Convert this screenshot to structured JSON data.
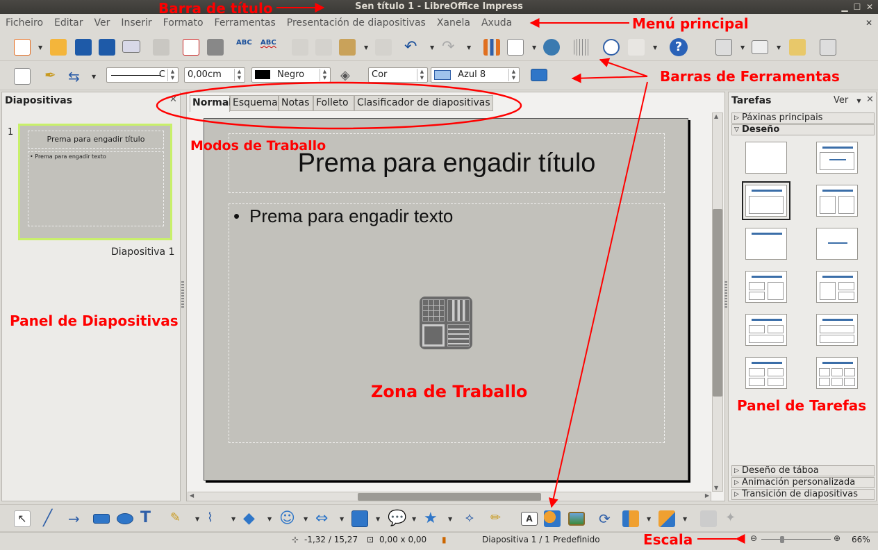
{
  "window": {
    "title": "Sen título 1 - LibreOffice Impress"
  },
  "menu": [
    "Ficheiro",
    "Editar",
    "Ver",
    "Inserir",
    "Formato",
    "Ferramentas",
    "Presentación de diapositivas",
    "Xanela",
    "Axuda"
  ],
  "line_toolbar": {
    "width_value": "0,00cm",
    "line_color": "Negro",
    "area_style": "Cor",
    "area_color": "Azul 8"
  },
  "slides_panel": {
    "title": "Diapositivas",
    "slide_number": "1",
    "thumb_title": "Prema para engadir título",
    "thumb_text": "• Prema para engadir texto",
    "slide_name": "Diapositiva 1"
  },
  "view_tabs": [
    "Normal",
    "Esquema",
    "Notas",
    "Folleto",
    "Clasificador de diapositivas"
  ],
  "slide": {
    "title_placeholder": "Prema para engadir título",
    "text_placeholder": "Prema para engadir texto",
    "bullet": "•"
  },
  "tasks_panel": {
    "title": "Tarefas",
    "view_label": "Ver",
    "sections_top": [
      "Páxinas principais",
      "Deseño"
    ],
    "sections_bottom": [
      "Deseño de táboa",
      "Animación personalizada",
      "Transición de diapositivas"
    ]
  },
  "statusbar": {
    "position": "-1,32 / 15,27",
    "size": "0,00 x 0,00",
    "slide": "Diapositiva 1 / 1",
    "master": "Predefinido",
    "zoom": "66%"
  },
  "annotations": {
    "title_bar": "Barra de título",
    "main_menu": "Menú principal",
    "toolbars": "Barras de Ferramentas",
    "work_modes": "Modos de Traballo",
    "slides_panel": "Panel de Diapositivas",
    "work_zone": "Zona de Traballo",
    "tasks_panel": "Panel de Tarefas",
    "scale": "Escala",
    "color": "#ff0000"
  }
}
